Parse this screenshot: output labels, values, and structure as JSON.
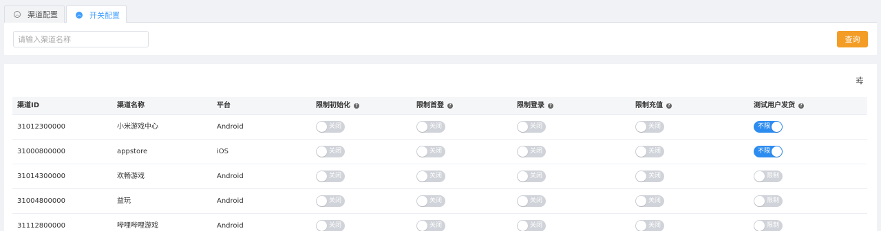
{
  "tabs": [
    {
      "label": "渠道配置",
      "icon": "chevron-up-circle-icon"
    },
    {
      "label": "开关配置",
      "icon": "chevron-up-circle-icon"
    }
  ],
  "search": {
    "placeholder": "请输入渠道名称",
    "value": ""
  },
  "query_button": "查询",
  "colors": {
    "accent": "#409eff",
    "query": "#f39d27",
    "switch_on": "#2d8cf0",
    "switch_off": "#d0d3d9"
  },
  "table": {
    "headers": [
      "渠道ID",
      "渠道名称",
      "平台",
      "限制初始化",
      "限制首登",
      "限制登录",
      "限制充值",
      "测试用户发货"
    ],
    "help_icon": "question-circle-icon",
    "rows": [
      {
        "id": "31012300000",
        "name": "小米游戏中心",
        "platform": "Android",
        "switches": [
          {
            "label": "关闭",
            "on": false
          },
          {
            "label": "关闭",
            "on": false
          },
          {
            "label": "关闭",
            "on": false
          },
          {
            "label": "关闭",
            "on": false
          },
          {
            "label": "不限",
            "on": true
          }
        ]
      },
      {
        "id": "31000800000",
        "name": "appstore",
        "platform": "iOS",
        "switches": [
          {
            "label": "关闭",
            "on": false
          },
          {
            "label": "关闭",
            "on": false
          },
          {
            "label": "关闭",
            "on": false
          },
          {
            "label": "关闭",
            "on": false
          },
          {
            "label": "不限",
            "on": true
          }
        ]
      },
      {
        "id": "31014300000",
        "name": "欢畅游戏",
        "platform": "Android",
        "switches": [
          {
            "label": "关闭",
            "on": false
          },
          {
            "label": "关闭",
            "on": false
          },
          {
            "label": "关闭",
            "on": false
          },
          {
            "label": "关闭",
            "on": false
          },
          {
            "label": "限制",
            "on": false
          }
        ]
      },
      {
        "id": "31004800000",
        "name": "益玩",
        "platform": "Android",
        "switches": [
          {
            "label": "关闭",
            "on": false
          },
          {
            "label": "关闭",
            "on": false
          },
          {
            "label": "关闭",
            "on": false
          },
          {
            "label": "关闭",
            "on": false
          },
          {
            "label": "限制",
            "on": false
          }
        ]
      },
      {
        "id": "31112800000",
        "name": "哔哩哔哩游戏",
        "platform": "Android",
        "switches": [
          {
            "label": "关闭",
            "on": false
          },
          {
            "label": "关闭",
            "on": false
          },
          {
            "label": "关闭",
            "on": false
          },
          {
            "label": "关闭",
            "on": false
          },
          {
            "label": "限制",
            "on": false
          }
        ]
      }
    ]
  }
}
